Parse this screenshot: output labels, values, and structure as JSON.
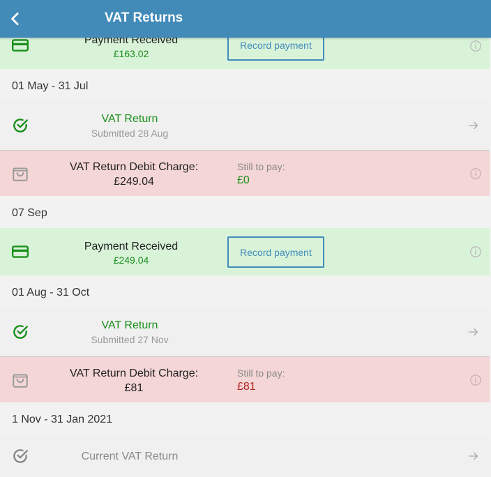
{
  "header": {
    "title": "VAT Returns"
  },
  "colors": {
    "header_bg": "#428bb9",
    "green_text": "#1a8f1a",
    "red_text": "#b22222",
    "green_bg": "#d9f3d9",
    "red_bg": "#f5d6d6"
  },
  "items": {
    "payment1": {
      "title": "Payment Received",
      "amount": "£163.02",
      "button": "Record payment"
    },
    "section1": "01 May - 31 Jul",
    "vat1": {
      "title": "VAT Return",
      "sub": "Submitted 28 Aug"
    },
    "debit1": {
      "title": "VAT Return Debit Charge:",
      "amount": "£249.04",
      "still_label": "Still to pay:",
      "still_value": "£0"
    },
    "section2": "07 Sep",
    "payment2": {
      "title": "Payment Received",
      "amount": "£249.04",
      "button": "Record payment"
    },
    "section3": "01 Aug - 31 Oct",
    "vat2": {
      "title": "VAT Return",
      "sub": "Submitted 27 Nov"
    },
    "debit2": {
      "title": "VAT Return Debit Charge:",
      "amount": "£81",
      "still_label": "Still to pay:",
      "still_value": "£81"
    },
    "section4": "1 Nov - 31 Jan 2021",
    "current": {
      "title": "Current VAT Return"
    }
  }
}
